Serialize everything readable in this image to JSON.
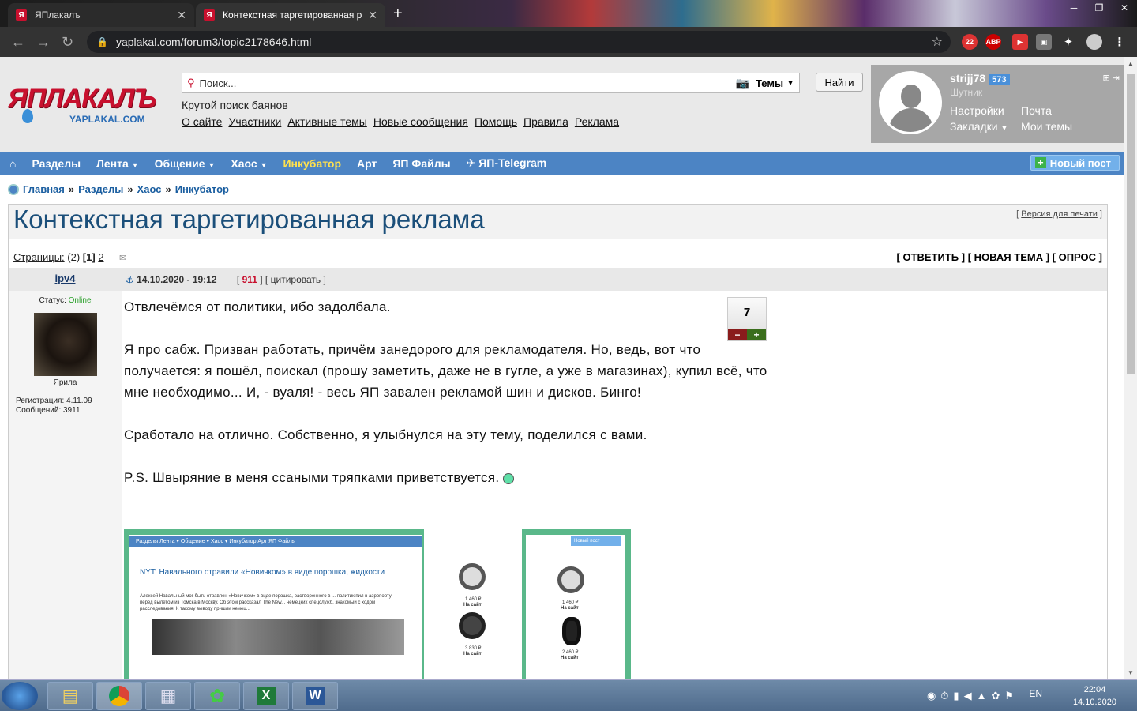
{
  "browser": {
    "tabs": [
      {
        "title": "ЯПлакалъ"
      },
      {
        "title": "Контекстная таргетированная р"
      }
    ],
    "url": "yaplakal.com/forum3/topic2178646.html",
    "ext_badge": "22",
    "abp": "ABP"
  },
  "site": {
    "logo_main": "ЯПЛАКАЛЪ",
    "logo_sub": "YAPLAKAL.COM",
    "search_placeholder": "Поиск...",
    "search_scope": "Темы",
    "find_button": "Найти",
    "subtitle": "Крутой поиск баянов",
    "toplinks": [
      "О сайте",
      "Участники",
      "Активные темы",
      "Новые сообщения",
      "Помощь",
      "Правила",
      "Реклама"
    ]
  },
  "user": {
    "name": "strijj78",
    "karma": "573",
    "rank": "Шутник",
    "settings": "Настройки",
    "mail": "Почта",
    "bookmarks": "Закладки",
    "mytopics": "Мои темы"
  },
  "menu": {
    "items": [
      "Разделы",
      "Лента",
      "Общение",
      "Хаос",
      "Инкубатор",
      "Арт",
      "ЯП Файлы",
      "ЯП-Telegram"
    ],
    "new_post": "Новый пост"
  },
  "breadcrumb": [
    "Главная",
    "Разделы",
    "Хаос",
    "Инкубатор"
  ],
  "topic": {
    "title": "Контекстная таргетированная реклама",
    "print_version": "Версия для печати",
    "pages_label": "Страницы:",
    "pages_count": "(2)",
    "page_current": "[1]",
    "page_next": "2",
    "reply": "[ ОТВЕТИТЬ ]",
    "new_topic": "[ НОВАЯ ТЕМА ]",
    "poll": "[ ОПРОС ]"
  },
  "post": {
    "author": "ipv4",
    "date": "14.10.2020 - 19:12",
    "post_id": "911",
    "quote": "цитировать",
    "status_label": "Статус:",
    "status": "Online",
    "avatar_caption": "Ярила",
    "reg": "Регистрация: 4.11.09",
    "messages": "Сообщений: 3911",
    "rating": "7",
    "paragraphs": [
      "Отвлечёмся от политики, ибо задолбала.",
      "Я про сабж. Призван работать, причём занедорого для рекламодателя. Но, ведь, вот что получается: я пошёл, поискал (прошу заметить, даже не в гугле, а уже в магазинах), купил всё, что мне необходимо... И, - вуаля! - весь ЯП завален рекламой шин и дисков. Бинго!",
      "Сработало на отлично. Собственно, я улыбнулся на эту тему, поделился с вами.",
      "P.S. Швыряние в меня ссаными тряпками приветствуется."
    ]
  },
  "screenshot": {
    "menu": "Разделы   Лента ▾   Общение ▾   Хаос ▾   Инкубатор   Арт   ЯП Файлы",
    "new_post": "Новый пост",
    "news_title": "NYT: Навального отравили «Новичком» в виде порошка, жидкости",
    "news_text": "Алексей Навальный мог быть отравлен «Новичком» в виде порошка, растворенного в ... политик пил в аэропорту перед вылетом из Томска в Москву. Об этом рассказал The New... немецких спецслужб, знакомый с ходом расследования. К такому выводу пришли немец...",
    "price1": "1 460 ₽",
    "price2": "3 830 ₽",
    "price3": "2 460 ₽",
    "onsite": "На сайт"
  },
  "taskbar": {
    "lang": "EN",
    "time": "22:04",
    "date": "14.10.2020"
  }
}
